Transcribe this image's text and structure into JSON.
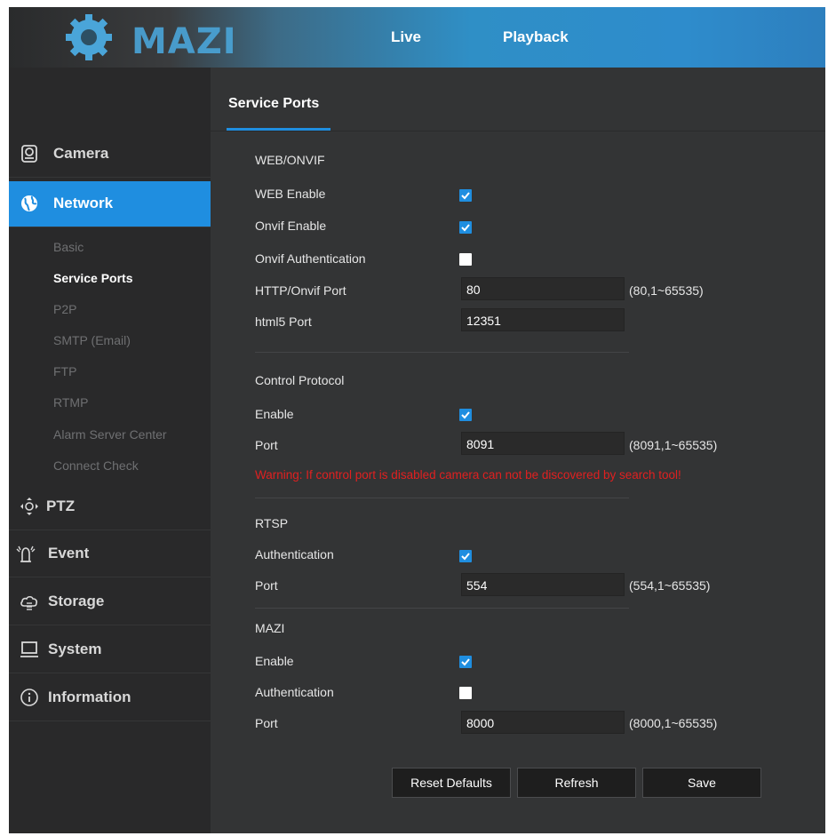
{
  "header": {
    "logo_text": "MAZI",
    "tabs": [
      {
        "label": "Live"
      },
      {
        "label": "Playback"
      }
    ]
  },
  "sidebar": {
    "items": [
      {
        "label": "Camera",
        "icon": "camera-icon"
      },
      {
        "label": "Network",
        "icon": "network-globe-icon",
        "active": true
      },
      {
        "label": "PTZ",
        "icon": "ptz-icon"
      },
      {
        "label": "Event",
        "icon": "alarm-icon"
      },
      {
        "label": "Storage",
        "icon": "cloud-storage-icon"
      },
      {
        "label": "System",
        "icon": "monitor-icon"
      },
      {
        "label": "Information",
        "icon": "info-icon"
      }
    ],
    "network_subitems": [
      {
        "label": "Basic"
      },
      {
        "label": "Service Ports",
        "active": true
      },
      {
        "label": "P2P"
      },
      {
        "label": "SMTP (Email)"
      },
      {
        "label": "FTP"
      },
      {
        "label": "RTMP"
      },
      {
        "label": "Alarm Server Center"
      },
      {
        "label": "Connect Check"
      }
    ]
  },
  "main": {
    "title": "Service Ports",
    "web_onvif": {
      "title": "WEB/ONVIF",
      "web_enable_label": "WEB Enable",
      "web_enable": true,
      "onvif_enable_label": "Onvif Enable",
      "onvif_enable": true,
      "onvif_auth_label": "Onvif Authentication",
      "onvif_auth": false,
      "http_port_label": "HTTP/Onvif Port",
      "http_port": "80",
      "http_range": "(80,1~65535)",
      "html5_port_label": "html5 Port",
      "html5_port": "12351"
    },
    "control_protocol": {
      "title": "Control Protocol",
      "enable_label": "Enable",
      "enable": true,
      "port_label": "Port",
      "port": "8091",
      "range": "(8091,1~65535)",
      "warning": "Warning: If control port is disabled camera can not be discovered by search tool!"
    },
    "rtsp": {
      "title": "RTSP",
      "auth_label": "Authentication",
      "auth": true,
      "port_label": "Port",
      "port": "554",
      "range": "(554,1~65535)"
    },
    "mazi": {
      "title": "MAZI",
      "enable_label": "Enable",
      "enable": true,
      "auth_label": "Authentication",
      "auth": false,
      "port_label": "Port",
      "port": "8000",
      "range": "(8000,1~65535)"
    },
    "buttons": {
      "reset": "Reset Defaults",
      "refresh": "Refresh",
      "save": "Save"
    }
  },
  "colors": {
    "accent": "#1f8ee0",
    "warning": "#e02020",
    "panel": "#333435",
    "sidebar": "#29292a"
  }
}
